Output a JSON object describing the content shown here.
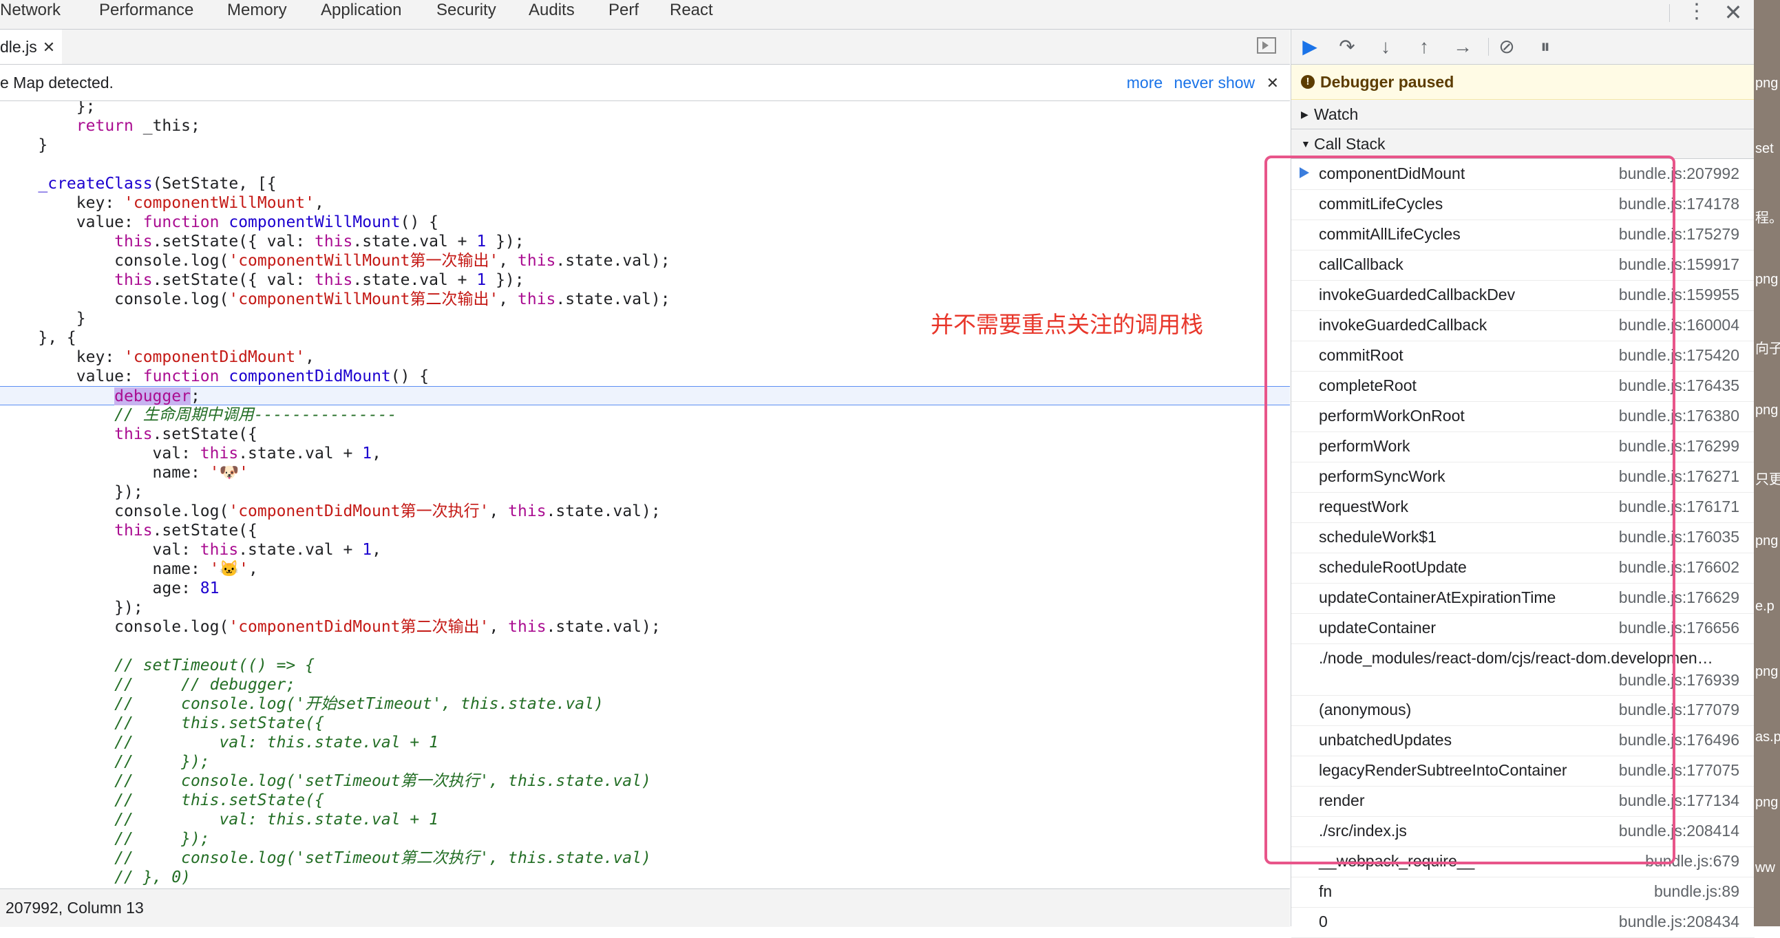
{
  "top_tabs": [
    "Network",
    "Performance",
    "Memory",
    "Application",
    "Security",
    "Audits",
    "Perf",
    "React"
  ],
  "top_bar": {
    "more_icon": "kebab-menu-icon",
    "close_icon": "close-icon",
    "more_glyph": "⋮",
    "close_glyph": "✕"
  },
  "file_tab": {
    "name": "dle.js",
    "close": "✕"
  },
  "sourcemap_bar": {
    "text": "e Map detected.",
    "more": "more",
    "never_show": "never show",
    "close": "✕"
  },
  "code_lines": [
    "        };",
    "        return _this;",
    "    }",
    "",
    "    _createClass(SetState, [{",
    "        key: 'componentWillMount',",
    "        value: function componentWillMount() {",
    "            this.setState({ val: this.state.val + 1 });",
    "            console.log('componentWillMount第一次输出', this.state.val);",
    "            this.setState({ val: this.state.val + 1 });",
    "            console.log('componentWillMount第二次输出', this.state.val);",
    "        }",
    "    }, {",
    "        key: 'componentDidMount',",
    "        value: function componentDidMount() {",
    "            debugger;",
    "            // 生命周期中调用---------------",
    "            this.setState({",
    "                val: this.state.val + 1,",
    "                name: '🐶'",
    "            });",
    "            console.log('componentDidMount第一次执行', this.state.val);",
    "            this.setState({",
    "                val: this.state.val + 1,",
    "                name: '🐱',",
    "                age: 81",
    "            });",
    "            console.log('componentDidMount第二次输出', this.state.val);",
    "",
    "            // setTimeout(() => {",
    "            //     // debugger;",
    "            //     console.log('开始setTimeout', this.state.val)",
    "            //     this.setState({",
    "            //         val: this.state.val + 1",
    "            //     });",
    "            //     console.log('setTimeout第一次执行', this.state.val)",
    "            //     this.setState({",
    "            //         val: this.state.val + 1",
    "            //     });",
    "            //     console.log('setTimeout第二次执行', this.state.val)",
    "            // }, 0)"
  ],
  "status_bar": "207992, Column 13",
  "annotation": "并不需要重点关注的调用栈",
  "debugger": {
    "paused_label": "Debugger paused",
    "watch_label": "Watch",
    "call_stack_label": "Call Stack",
    "call_stack": [
      {
        "name": "componentDidMount",
        "location": "bundle.js:207992"
      },
      {
        "name": "commitLifeCycles",
        "location": "bundle.js:174178"
      },
      {
        "name": "commitAllLifeCycles",
        "location": "bundle.js:175279"
      },
      {
        "name": "callCallback",
        "location": "bundle.js:159917"
      },
      {
        "name": "invokeGuardedCallbackDev",
        "location": "bundle.js:159955"
      },
      {
        "name": "invokeGuardedCallback",
        "location": "bundle.js:160004"
      },
      {
        "name": "commitRoot",
        "location": "bundle.js:175420"
      },
      {
        "name": "completeRoot",
        "location": "bundle.js:176435"
      },
      {
        "name": "performWorkOnRoot",
        "location": "bundle.js:176380"
      },
      {
        "name": "performWork",
        "location": "bundle.js:176299"
      },
      {
        "name": "performSyncWork",
        "location": "bundle.js:176271"
      },
      {
        "name": "requestWork",
        "location": "bundle.js:176171"
      },
      {
        "name": "scheduleWork$1",
        "location": "bundle.js:176035"
      },
      {
        "name": "scheduleRootUpdate",
        "location": "bundle.js:176602"
      },
      {
        "name": "updateContainerAtExpirationTime",
        "location": "bundle.js:176629"
      },
      {
        "name": "updateContainer",
        "location": "bundle.js:176656"
      },
      {
        "name": "./node_modules/react-dom/cjs/react-dom.developmen…",
        "location": "bundle.js:176939"
      },
      {
        "name": "(anonymous)",
        "location": "bundle.js:177079"
      },
      {
        "name": "unbatchedUpdates",
        "location": "bundle.js:176496"
      },
      {
        "name": "legacyRenderSubtreeIntoContainer",
        "location": "bundle.js:177075"
      },
      {
        "name": "render",
        "location": "bundle.js:177134"
      },
      {
        "name": "./src/index.js",
        "location": "bundle.js:208414"
      },
      {
        "name": "__webpack_require__",
        "location": "bundle.js:679"
      },
      {
        "name": "fn",
        "location": "bundle.js:89"
      },
      {
        "name": "0",
        "location": "bundle.js:208434"
      }
    ]
  },
  "edge_fragments": [
    "png",
    "set",
    "程。",
    "png",
    "向子",
    "png",
    "只更",
    "png",
    "e.p",
    "png",
    "as.p",
    "png",
    "ww"
  ],
  "colors": {
    "accent": "#1a73e8",
    "annotation": "#e8362a",
    "highlight_box": "#e8558a",
    "paused_bg": "#fffbe5"
  }
}
